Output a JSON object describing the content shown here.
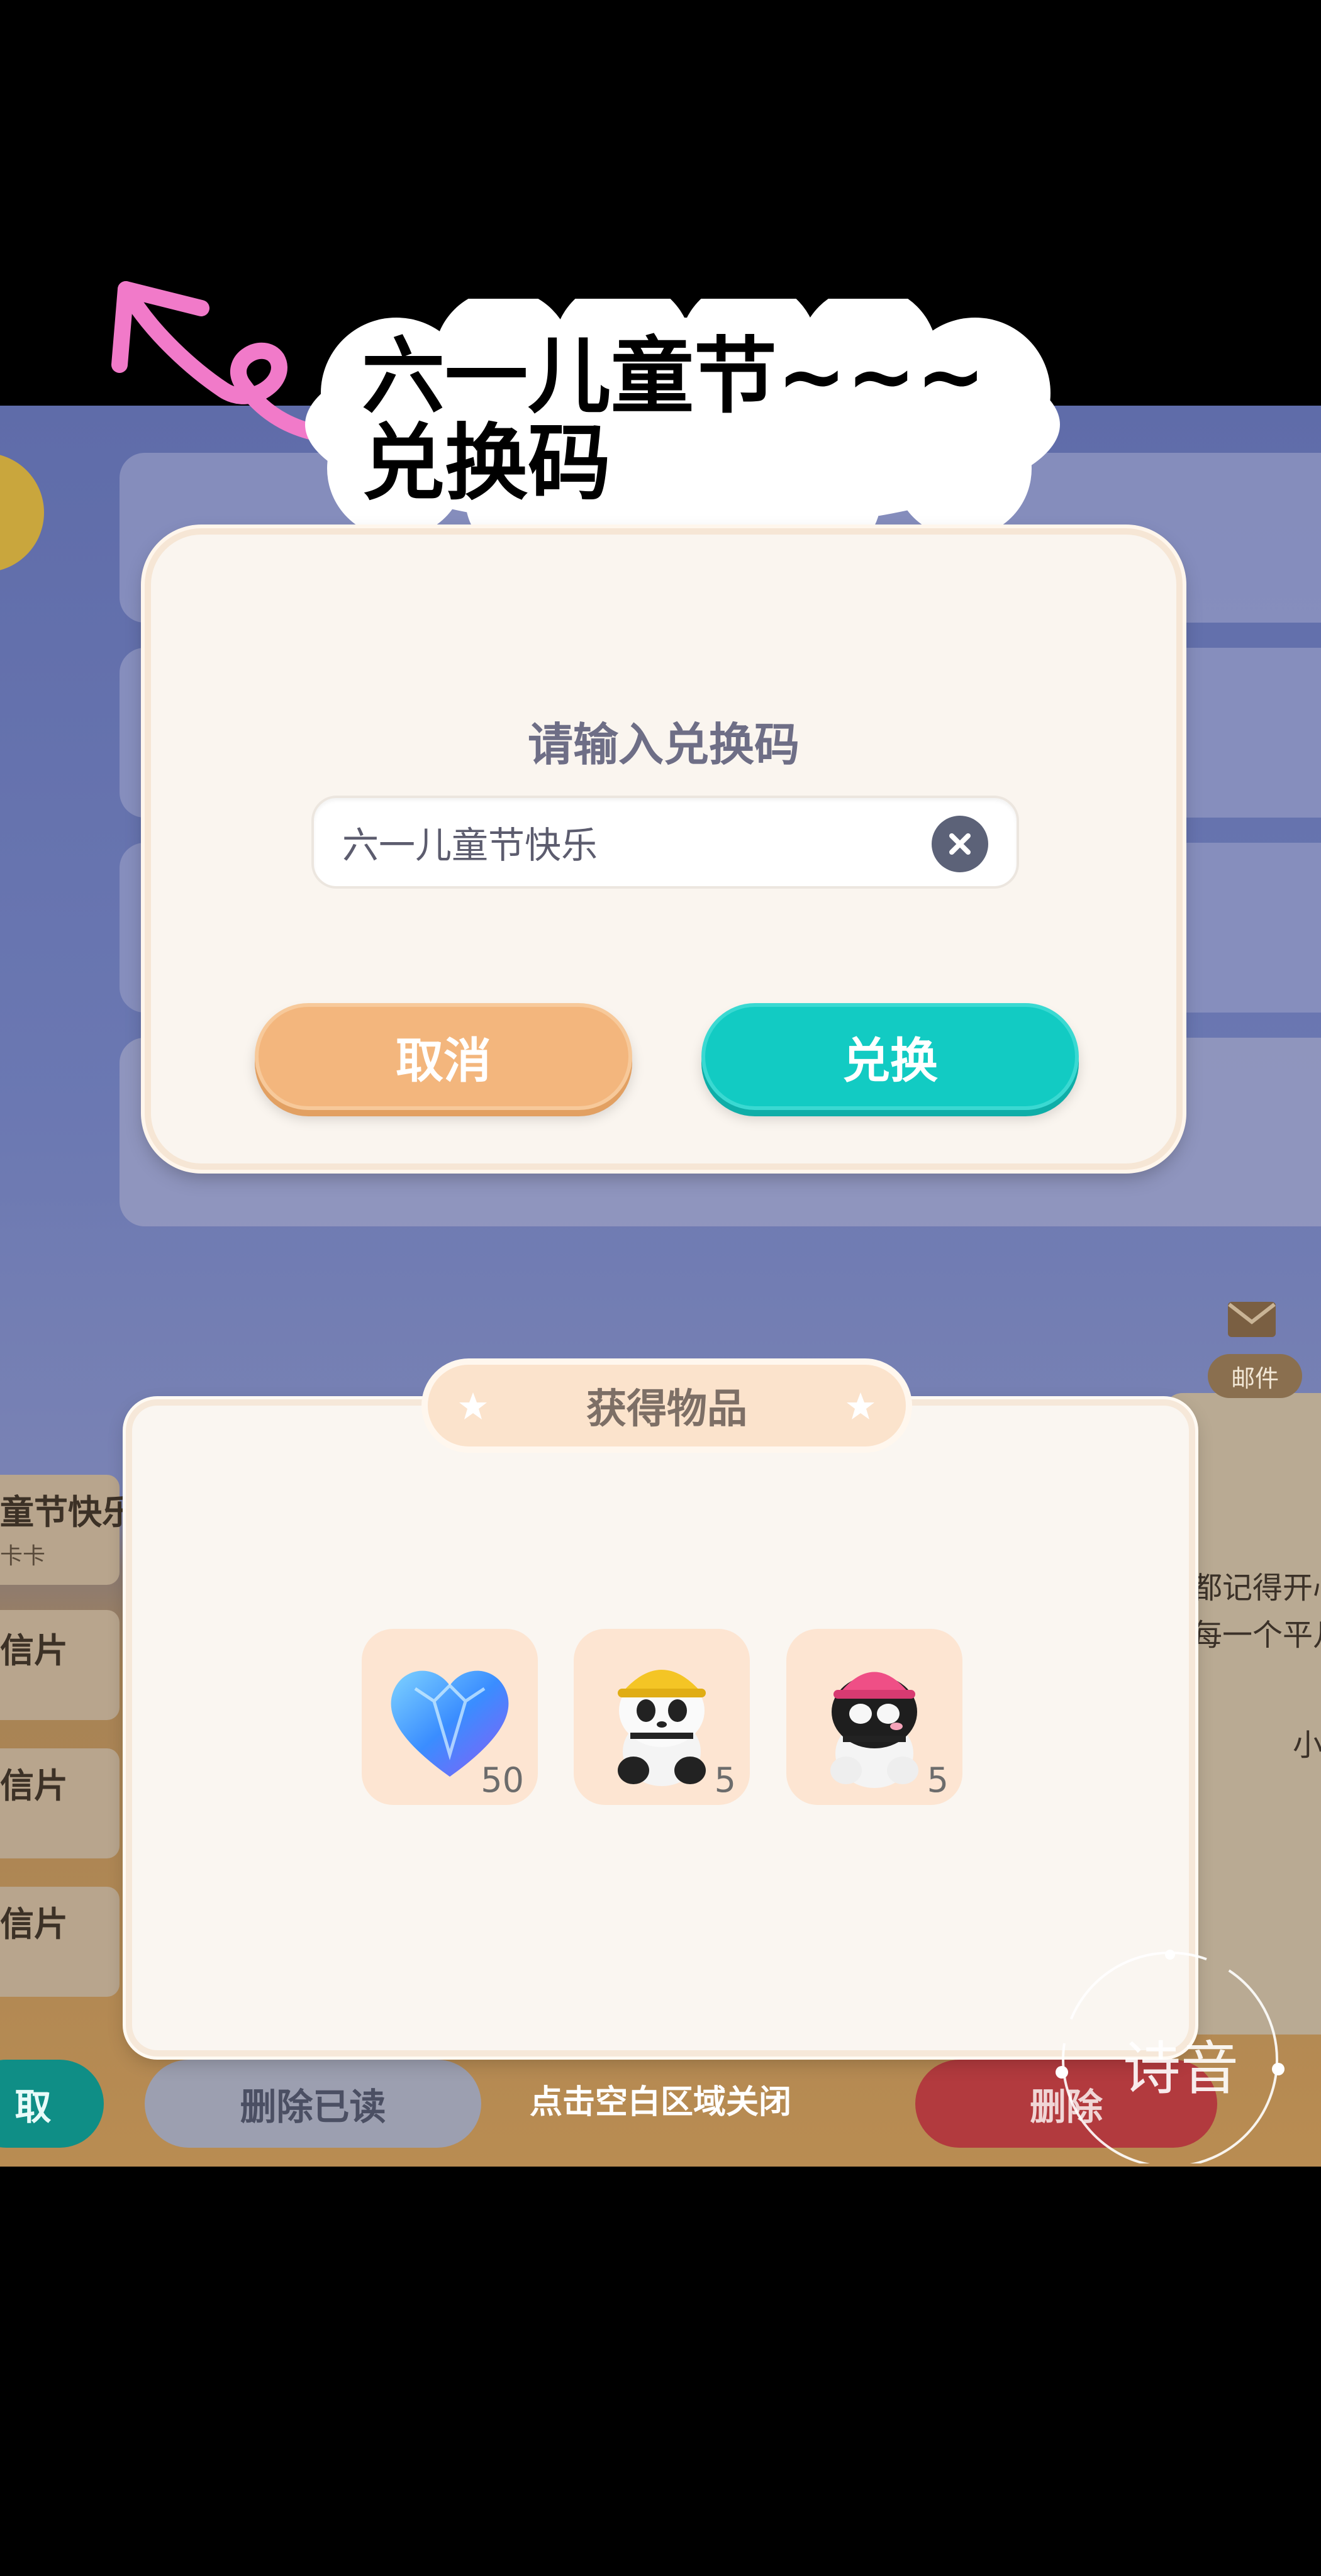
{
  "annotation": {
    "title": "六一儿童节~~~\n兑换码"
  },
  "redeem_dialog": {
    "prompt": "请输入兑换码",
    "code_value": "六一儿童节快乐",
    "cancel_label": "取消",
    "confirm_label": "兑换"
  },
  "items_panel": {
    "title": "获得物品",
    "items": [
      {
        "icon": "blue-heart-gem-icon",
        "count": "50"
      },
      {
        "icon": "panda-yellow-hat-icon",
        "count": "5"
      },
      {
        "icon": "panda-pink-hat-icon",
        "count": "5"
      }
    ],
    "close_hint": "点击空白区域关闭"
  },
  "background": {
    "list_items": [
      {
        "title": "童节快乐",
        "subtitle": "卡卡"
      },
      {
        "title": "信片"
      },
      {
        "title": "信片"
      },
      {
        "title": "信片"
      }
    ],
    "right_text_1": "都记得开心",
    "right_text_2": "每一个平凡",
    "right_text_3": "小",
    "mail_label": "邮件",
    "btn_left_partial": "取",
    "btn_delete_read": "删除已读",
    "btn_delete": "删除"
  },
  "watermark": {
    "text": "诗音"
  },
  "colors": {
    "cancel": "#f3b67d",
    "confirm": "#12cbc3",
    "panel": "#faf6f1"
  }
}
